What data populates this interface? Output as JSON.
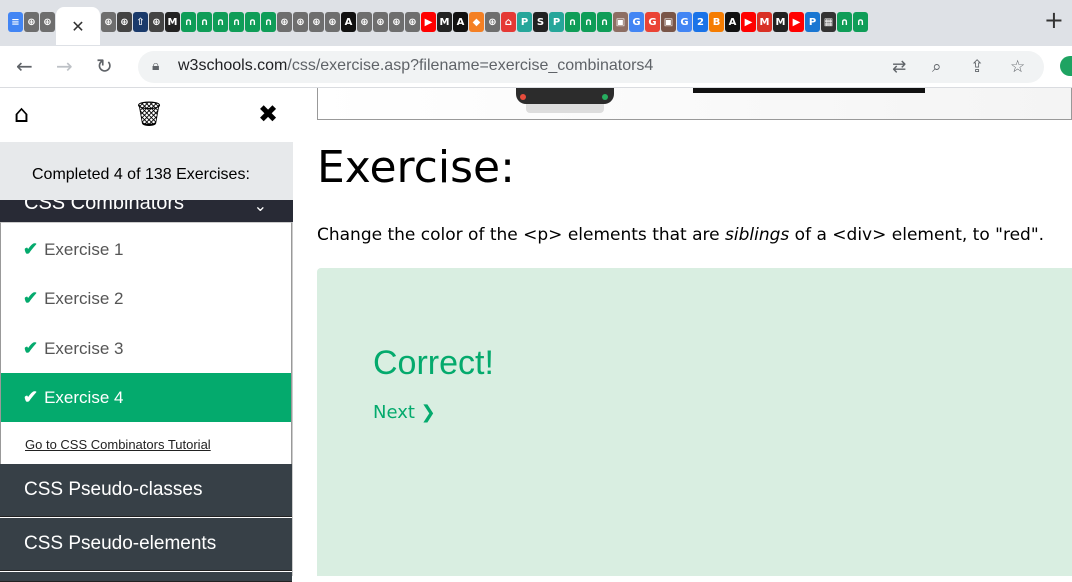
{
  "browser": {
    "tabs": [
      {
        "icon": "w3schools-icon",
        "color": "#4285f4",
        "glyph": "≡"
      },
      {
        "icon": "openai-icon",
        "color": "#6e6e6e",
        "glyph": "⊕"
      },
      {
        "icon": "openai-icon",
        "color": "#6e6e6e",
        "glyph": "⊕"
      },
      {
        "icon": "openai-icon",
        "color": "#6e6e6e",
        "glyph": "⊕"
      },
      {
        "icon": "openai-icon",
        "color": "#444",
        "glyph": "⊕"
      },
      {
        "icon": "upload-icon",
        "color": "#1a3a6b",
        "glyph": "⇧"
      },
      {
        "icon": "openai-icon",
        "color": "#444",
        "glyph": "⊕"
      },
      {
        "icon": "m-icon",
        "color": "#222",
        "glyph": "M"
      },
      {
        "icon": "n-icon",
        "color": "#0f9d58",
        "glyph": "∩"
      },
      {
        "icon": "n-icon",
        "color": "#0f9d58",
        "glyph": "∩"
      },
      {
        "icon": "n-icon",
        "color": "#0f9d58",
        "glyph": "∩"
      },
      {
        "icon": "n-icon",
        "color": "#0f9d58",
        "glyph": "∩"
      },
      {
        "icon": "n-icon",
        "color": "#0f9d58",
        "glyph": "∩"
      },
      {
        "icon": "n-icon",
        "color": "#0f9d58",
        "glyph": "∩"
      },
      {
        "icon": "openai-icon",
        "color": "#6e6e6e",
        "glyph": "⊕"
      },
      {
        "icon": "openai-icon",
        "color": "#6e6e6e",
        "glyph": "⊕"
      },
      {
        "icon": "openai-icon",
        "color": "#6e6e6e",
        "glyph": "⊕"
      },
      {
        "icon": "openai-icon",
        "color": "#6e6e6e",
        "glyph": "⊕"
      },
      {
        "icon": "a-icon",
        "color": "#111",
        "glyph": "A"
      },
      {
        "icon": "openai-icon",
        "color": "#6e6e6e",
        "glyph": "⊕"
      },
      {
        "icon": "openai-icon",
        "color": "#6e6e6e",
        "glyph": "⊕"
      },
      {
        "icon": "openai-icon",
        "color": "#6e6e6e",
        "glyph": "⊕"
      },
      {
        "icon": "openai-icon",
        "color": "#6e6e6e",
        "glyph": "⊕"
      },
      {
        "icon": "youtube-icon",
        "color": "#ff0000",
        "glyph": "▶"
      },
      {
        "icon": "m-icon",
        "color": "#222",
        "glyph": "M"
      },
      {
        "icon": "a-icon",
        "color": "#111",
        "glyph": "A"
      },
      {
        "icon": "dropbox-icon",
        "color": "#f48024",
        "glyph": "◆"
      },
      {
        "icon": "openai-icon",
        "color": "#6e6e6e",
        "glyph": "⊕"
      },
      {
        "icon": "home-icon",
        "color": "#e53935",
        "glyph": "⌂"
      },
      {
        "icon": "p-icon",
        "color": "#26a69a",
        "glyph": "P"
      },
      {
        "icon": "s-icon",
        "color": "#222",
        "glyph": "S"
      },
      {
        "icon": "p-icon",
        "color": "#26a69a",
        "glyph": "P"
      },
      {
        "icon": "n-icon",
        "color": "#0f9d58",
        "glyph": "∩"
      },
      {
        "icon": "n-icon",
        "color": "#0f9d58",
        "glyph": "∩"
      },
      {
        "icon": "n-icon",
        "color": "#0f9d58",
        "glyph": "∩"
      },
      {
        "icon": "image-icon",
        "color": "#8d6e63",
        "glyph": "▣"
      },
      {
        "icon": "google-icon",
        "color": "#4285f4",
        "glyph": "G"
      },
      {
        "icon": "google-icon",
        "color": "#ea4335",
        "glyph": "G"
      },
      {
        "icon": "image-icon",
        "color": "#795548",
        "glyph": "▣"
      },
      {
        "icon": "google-icon",
        "color": "#4285f4",
        "glyph": "G"
      },
      {
        "icon": "calendar-icon",
        "color": "#1a73e8",
        "glyph": "2"
      },
      {
        "icon": "blogger-icon",
        "color": "#f57c00",
        "glyph": "B"
      },
      {
        "icon": "a-icon",
        "color": "#111",
        "glyph": "A"
      },
      {
        "icon": "youtube-icon",
        "color": "#ff0000",
        "glyph": "▶"
      },
      {
        "icon": "gmail-icon",
        "color": "#d93025",
        "glyph": "M"
      },
      {
        "icon": "m-icon",
        "color": "#222",
        "glyph": "M"
      },
      {
        "icon": "youtube-icon",
        "color": "#ff0000",
        "glyph": "▶"
      },
      {
        "icon": "p-icon",
        "color": "#1976d2",
        "glyph": "P"
      },
      {
        "icon": "pdf-icon",
        "color": "#333",
        "glyph": "▦"
      },
      {
        "icon": "n-icon",
        "color": "#0f9d58",
        "glyph": "∩"
      },
      {
        "icon": "n-icon",
        "color": "#0f9d58",
        "glyph": "∩"
      }
    ],
    "active_tab_close": "✕",
    "new_tab": "+",
    "url_host": "w3schools.com",
    "url_path": "/css/exercise.asp?filename=exercise_combinators4"
  },
  "sidebar": {
    "home_icon": "home-icon",
    "trash_icon": "trash-icon",
    "close_icon": "close-icon",
    "progress_text": "Completed 4 of 138 Exercises:",
    "category": "CSS Combinators",
    "exercises": [
      {
        "label": "Exercise 1",
        "active": false
      },
      {
        "label": "Exercise 2",
        "active": false
      },
      {
        "label": "Exercise 3",
        "active": false
      },
      {
        "label": "Exercise 4",
        "active": true
      }
    ],
    "tutorial_link": "Go to CSS Combinators Tutorial",
    "sections": [
      "CSS Pseudo-classes",
      "CSS Pseudo-elements"
    ]
  },
  "main": {
    "title": "Exercise:",
    "desc_before": "Change the color of the <p> elements that are ",
    "desc_em": "siblings",
    "desc_after": " of a <div> element, to \"red\".",
    "result_title": "Correct!",
    "next_label": "Next ❯"
  },
  "colors": {
    "accent": "#04aa6d",
    "sidebar_dark": "#374047",
    "result_bg": "#d9eee1"
  }
}
